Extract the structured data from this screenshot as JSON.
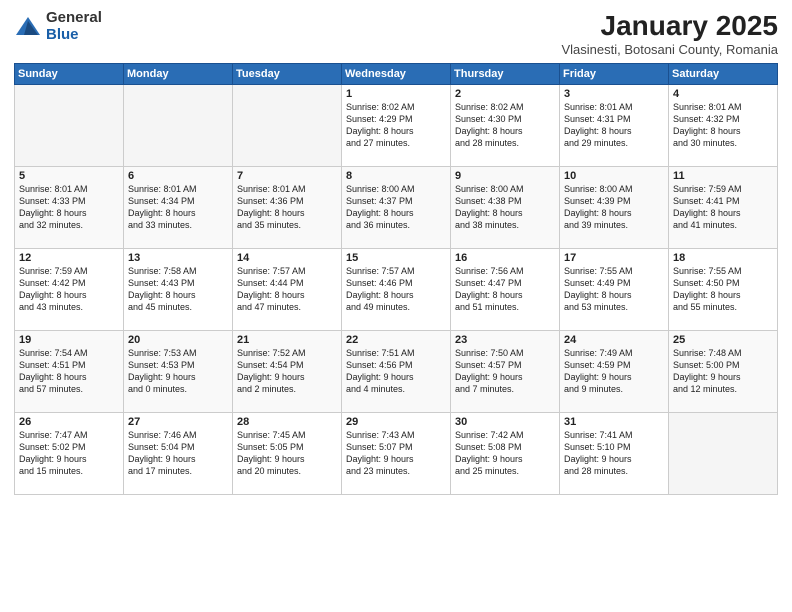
{
  "logo": {
    "general": "General",
    "blue": "Blue"
  },
  "title": "January 2025",
  "subtitle": "Vlasinesti, Botosani County, Romania",
  "days_header": [
    "Sunday",
    "Monday",
    "Tuesday",
    "Wednesday",
    "Thursday",
    "Friday",
    "Saturday"
  ],
  "weeks": [
    {
      "row_class": "row-white",
      "days": [
        {
          "num": "",
          "info": "",
          "empty": true
        },
        {
          "num": "",
          "info": "",
          "empty": true
        },
        {
          "num": "",
          "info": "",
          "empty": true
        },
        {
          "num": "1",
          "info": "Sunrise: 8:02 AM\nSunset: 4:29 PM\nDaylight: 8 hours\nand 27 minutes.",
          "empty": false
        },
        {
          "num": "2",
          "info": "Sunrise: 8:02 AM\nSunset: 4:30 PM\nDaylight: 8 hours\nand 28 minutes.",
          "empty": false
        },
        {
          "num": "3",
          "info": "Sunrise: 8:01 AM\nSunset: 4:31 PM\nDaylight: 8 hours\nand 29 minutes.",
          "empty": false
        },
        {
          "num": "4",
          "info": "Sunrise: 8:01 AM\nSunset: 4:32 PM\nDaylight: 8 hours\nand 30 minutes.",
          "empty": false
        }
      ]
    },
    {
      "row_class": "row-gray",
      "days": [
        {
          "num": "5",
          "info": "Sunrise: 8:01 AM\nSunset: 4:33 PM\nDaylight: 8 hours\nand 32 minutes.",
          "empty": false
        },
        {
          "num": "6",
          "info": "Sunrise: 8:01 AM\nSunset: 4:34 PM\nDaylight: 8 hours\nand 33 minutes.",
          "empty": false
        },
        {
          "num": "7",
          "info": "Sunrise: 8:01 AM\nSunset: 4:36 PM\nDaylight: 8 hours\nand 35 minutes.",
          "empty": false
        },
        {
          "num": "8",
          "info": "Sunrise: 8:00 AM\nSunset: 4:37 PM\nDaylight: 8 hours\nand 36 minutes.",
          "empty": false
        },
        {
          "num": "9",
          "info": "Sunrise: 8:00 AM\nSunset: 4:38 PM\nDaylight: 8 hours\nand 38 minutes.",
          "empty": false
        },
        {
          "num": "10",
          "info": "Sunrise: 8:00 AM\nSunset: 4:39 PM\nDaylight: 8 hours\nand 39 minutes.",
          "empty": false
        },
        {
          "num": "11",
          "info": "Sunrise: 7:59 AM\nSunset: 4:41 PM\nDaylight: 8 hours\nand 41 minutes.",
          "empty": false
        }
      ]
    },
    {
      "row_class": "row-white",
      "days": [
        {
          "num": "12",
          "info": "Sunrise: 7:59 AM\nSunset: 4:42 PM\nDaylight: 8 hours\nand 43 minutes.",
          "empty": false
        },
        {
          "num": "13",
          "info": "Sunrise: 7:58 AM\nSunset: 4:43 PM\nDaylight: 8 hours\nand 45 minutes.",
          "empty": false
        },
        {
          "num": "14",
          "info": "Sunrise: 7:57 AM\nSunset: 4:44 PM\nDaylight: 8 hours\nand 47 minutes.",
          "empty": false
        },
        {
          "num": "15",
          "info": "Sunrise: 7:57 AM\nSunset: 4:46 PM\nDaylight: 8 hours\nand 49 minutes.",
          "empty": false
        },
        {
          "num": "16",
          "info": "Sunrise: 7:56 AM\nSunset: 4:47 PM\nDaylight: 8 hours\nand 51 minutes.",
          "empty": false
        },
        {
          "num": "17",
          "info": "Sunrise: 7:55 AM\nSunset: 4:49 PM\nDaylight: 8 hours\nand 53 minutes.",
          "empty": false
        },
        {
          "num": "18",
          "info": "Sunrise: 7:55 AM\nSunset: 4:50 PM\nDaylight: 8 hours\nand 55 minutes.",
          "empty": false
        }
      ]
    },
    {
      "row_class": "row-gray",
      "days": [
        {
          "num": "19",
          "info": "Sunrise: 7:54 AM\nSunset: 4:51 PM\nDaylight: 8 hours\nand 57 minutes.",
          "empty": false
        },
        {
          "num": "20",
          "info": "Sunrise: 7:53 AM\nSunset: 4:53 PM\nDaylight: 9 hours\nand 0 minutes.",
          "empty": false
        },
        {
          "num": "21",
          "info": "Sunrise: 7:52 AM\nSunset: 4:54 PM\nDaylight: 9 hours\nand 2 minutes.",
          "empty": false
        },
        {
          "num": "22",
          "info": "Sunrise: 7:51 AM\nSunset: 4:56 PM\nDaylight: 9 hours\nand 4 minutes.",
          "empty": false
        },
        {
          "num": "23",
          "info": "Sunrise: 7:50 AM\nSunset: 4:57 PM\nDaylight: 9 hours\nand 7 minutes.",
          "empty": false
        },
        {
          "num": "24",
          "info": "Sunrise: 7:49 AM\nSunset: 4:59 PM\nDaylight: 9 hours\nand 9 minutes.",
          "empty": false
        },
        {
          "num": "25",
          "info": "Sunrise: 7:48 AM\nSunset: 5:00 PM\nDaylight: 9 hours\nand 12 minutes.",
          "empty": false
        }
      ]
    },
    {
      "row_class": "row-white",
      "days": [
        {
          "num": "26",
          "info": "Sunrise: 7:47 AM\nSunset: 5:02 PM\nDaylight: 9 hours\nand 15 minutes.",
          "empty": false
        },
        {
          "num": "27",
          "info": "Sunrise: 7:46 AM\nSunset: 5:04 PM\nDaylight: 9 hours\nand 17 minutes.",
          "empty": false
        },
        {
          "num": "28",
          "info": "Sunrise: 7:45 AM\nSunset: 5:05 PM\nDaylight: 9 hours\nand 20 minutes.",
          "empty": false
        },
        {
          "num": "29",
          "info": "Sunrise: 7:43 AM\nSunset: 5:07 PM\nDaylight: 9 hours\nand 23 minutes.",
          "empty": false
        },
        {
          "num": "30",
          "info": "Sunrise: 7:42 AM\nSunset: 5:08 PM\nDaylight: 9 hours\nand 25 minutes.",
          "empty": false
        },
        {
          "num": "31",
          "info": "Sunrise: 7:41 AM\nSunset: 5:10 PM\nDaylight: 9 hours\nand 28 minutes.",
          "empty": false
        },
        {
          "num": "",
          "info": "",
          "empty": true
        }
      ]
    }
  ]
}
